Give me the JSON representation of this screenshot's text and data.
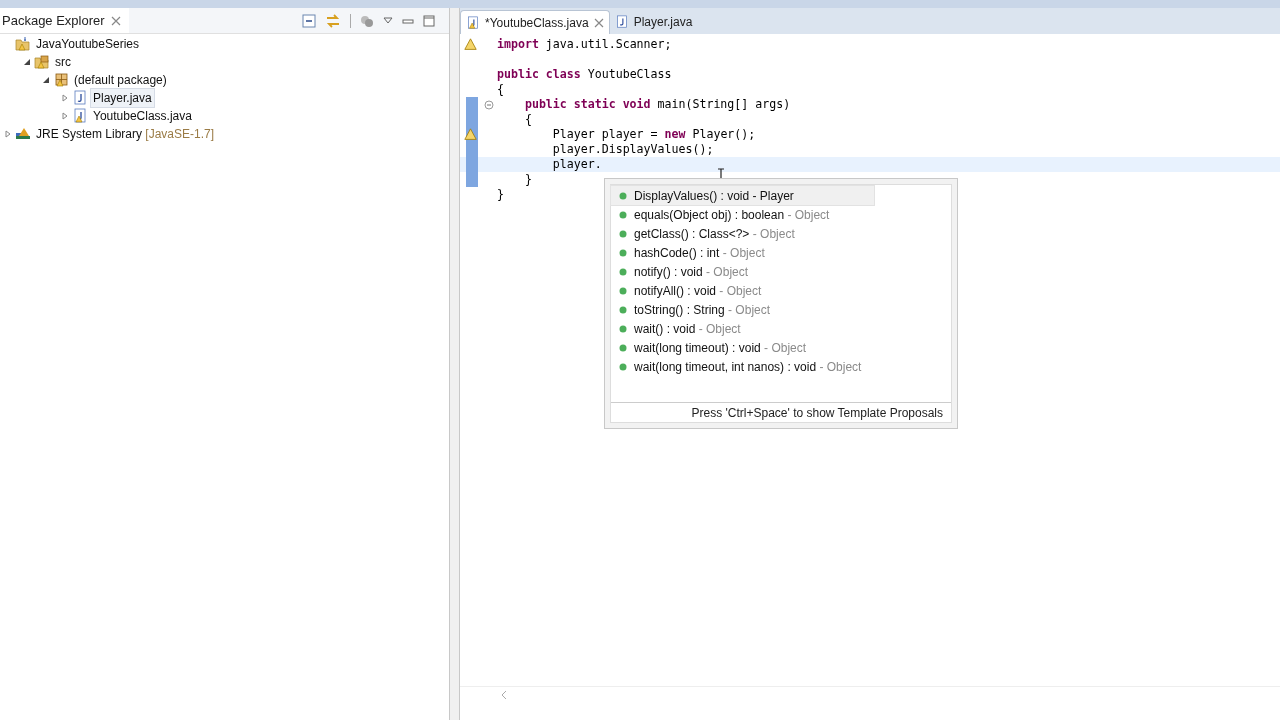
{
  "package_explorer": {
    "title": "Package Explorer",
    "tree": [
      {
        "label": "JavaYoutubeSeries",
        "kind": "project",
        "selected": false,
        "children": [
          {
            "label": "src",
            "kind": "source-folder",
            "expanded": true,
            "selected": false,
            "children": [
              {
                "label": "(default package)",
                "kind": "package",
                "expanded": true,
                "selected": false,
                "children": [
                  {
                    "label": "Player.java",
                    "kind": "java-file",
                    "expanded": false,
                    "selected": true,
                    "warning": false
                  },
                  {
                    "label": "YoutubeClass.java",
                    "kind": "java-file",
                    "expanded": false,
                    "selected": false,
                    "warning": true
                  }
                ]
              }
            ]
          }
        ]
      },
      {
        "label": "JRE System Library",
        "decoration": "[JavaSE-1.7]",
        "kind": "library",
        "expanded": false,
        "selected": false
      }
    ]
  },
  "editor": {
    "tabs": [
      {
        "label": "*YoutubeClass.java",
        "selected": true,
        "warning": true
      },
      {
        "label": "Player.java",
        "selected": false,
        "warning": false
      }
    ],
    "lines": [
      {
        "tokens": [
          {
            "text": "import",
            "kind": "keyword"
          },
          {
            "text": " java.util.Scanner;",
            "kind": "plain"
          }
        ],
        "warning": true,
        "current": false
      },
      {
        "current": false
      },
      {
        "tokens": [
          {
            "text": "public class",
            "kind": "keyword"
          },
          {
            "text": " YoutubeClass",
            "kind": "plain"
          }
        ],
        "current": false
      },
      {
        "tokens": [
          {
            "text": "{",
            "kind": "plain"
          }
        ],
        "current": false
      },
      {
        "tokens": [
          {
            "text": "    public static void",
            "kind": "keyword"
          },
          {
            "text": " main(String[] args)",
            "kind": "plain"
          }
        ],
        "foldable": true,
        "current": false
      },
      {
        "tokens": [
          {
            "text": "    {",
            "kind": "plain"
          }
        ],
        "current": false
      },
      {
        "tokens": [
          {
            "text": "        Player player = ",
            "kind": "plain"
          },
          {
            "text": "new",
            "kind": "keyword"
          },
          {
            "text": " Player();",
            "kind": "plain"
          }
        ],
        "warning": true,
        "current": false
      },
      {
        "tokens": [
          {
            "text": "        player.DisplayValues();",
            "kind": "plain"
          }
        ],
        "current": false
      },
      {
        "tokens": [
          {
            "text": "        player.",
            "kind": "plain"
          }
        ],
        "current": true
      },
      {
        "tokens": [
          {
            "text": "    }",
            "kind": "plain"
          }
        ],
        "current": false
      },
      {
        "tokens": [
          {
            "text": "}",
            "kind": "plain"
          }
        ],
        "current": false
      }
    ]
  },
  "completion": {
    "proposals": [
      {
        "signature": "DisplayValues() : void",
        "owner": " - Player",
        "selected": true
      },
      {
        "signature": "equals(Object obj) : boolean",
        "owner": " - Object",
        "selected": false
      },
      {
        "signature": "getClass() : Class<?>",
        "owner": " - Object",
        "selected": false
      },
      {
        "signature": "hashCode() : int",
        "owner": " - Object",
        "selected": false
      },
      {
        "signature": "notify() : void",
        "owner": " - Object",
        "selected": false
      },
      {
        "signature": "notifyAll() : void",
        "owner": " - Object",
        "selected": false
      },
      {
        "signature": "toString() : String",
        "owner": " - Object",
        "selected": false
      },
      {
        "signature": "wait() : void",
        "owner": " - Object",
        "selected": false
      },
      {
        "signature": "wait(long timeout) : void",
        "owner": " - Object",
        "selected": false
      },
      {
        "signature": "wait(long timeout, int nanos) : void",
        "owner": " - Object",
        "selected": false
      }
    ],
    "footer": "Press 'Ctrl+Space' to show Template Proposals"
  }
}
